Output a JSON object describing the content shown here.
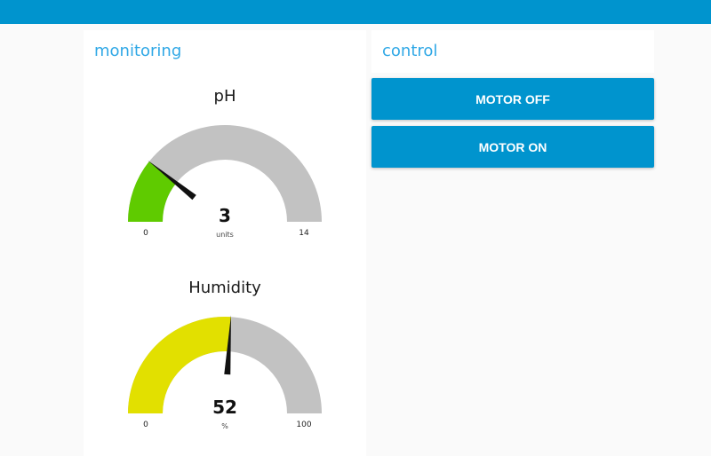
{
  "colors": {
    "topbar": "#0094ce",
    "title": "#30a8e6",
    "gauge_track": "#c2c2c2",
    "button": "#0094ce",
    "ph_fill": "#5fcb00",
    "humidity_fill": "#e2e000"
  },
  "monitoring": {
    "title": "monitoring",
    "ph": {
      "label": "pH",
      "value": "3",
      "units": "units",
      "min": "0",
      "max": "14",
      "value_num": 3,
      "min_num": 0,
      "max_num": 14
    },
    "humidity": {
      "label": "Humidity",
      "value": "52",
      "units": "%",
      "min": "0",
      "max": "100",
      "value_num": 52,
      "min_num": 0,
      "max_num": 100
    }
  },
  "control": {
    "title": "control",
    "motor_off_label": "MOTOR OFF",
    "motor_on_label": "MOTOR ON"
  }
}
